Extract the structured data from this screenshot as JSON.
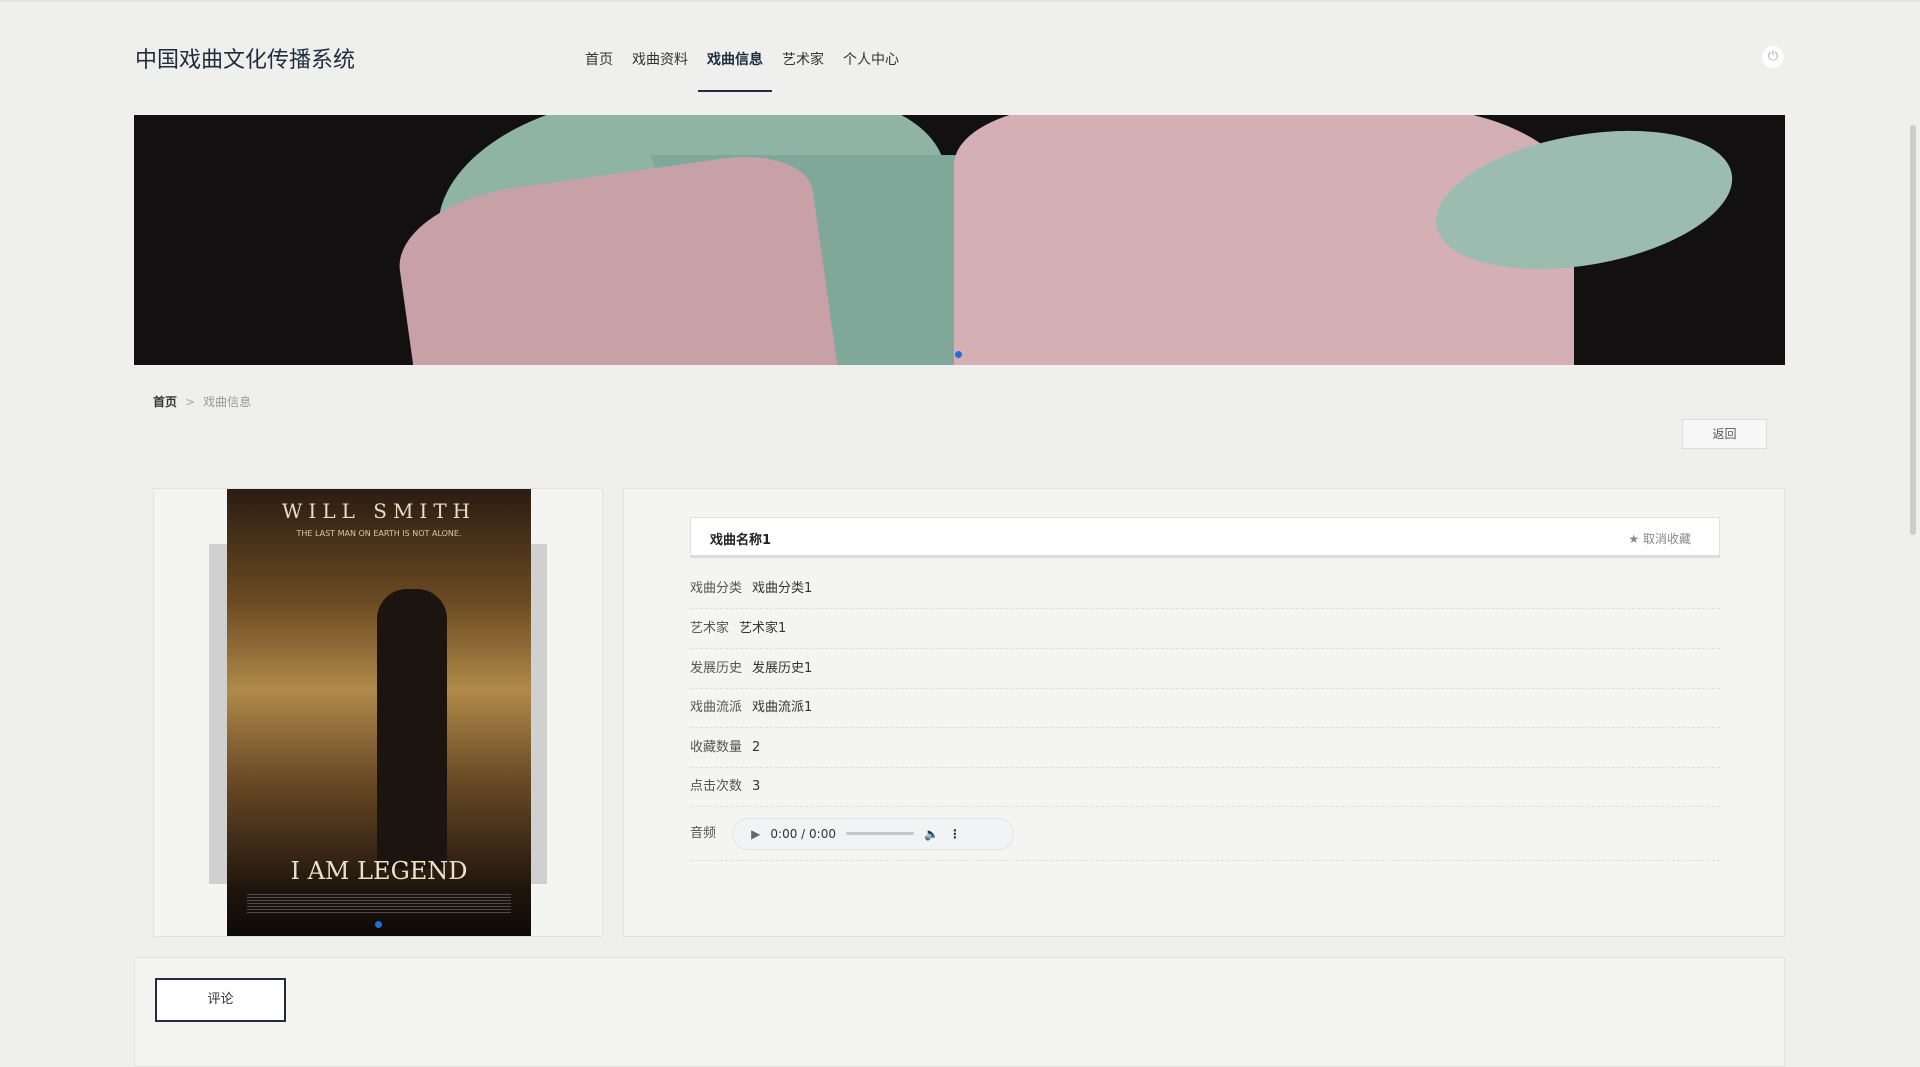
{
  "header": {
    "title": "中国戏曲文化传播系统",
    "nav": [
      "首页",
      "戏曲资料",
      "戏曲信息",
      "艺术家",
      "个人中心"
    ],
    "active_index": 2,
    "power_icon": "power-icon"
  },
  "breadcrumb": {
    "home": "首页",
    "separator": ">",
    "current": "戏曲信息"
  },
  "back_label": "返回",
  "poster": {
    "top_text": "WILL SMITH",
    "tagline": "THE LAST MAN ON EARTH IS NOT ALONE.",
    "bottom_text": "I AM LEGEND"
  },
  "detail": {
    "name": "戏曲名称1",
    "favorite_label": "取消收藏",
    "rows": [
      {
        "label": "戏曲分类",
        "value": "戏曲分类1"
      },
      {
        "label": "艺术家",
        "value": "艺术家1"
      },
      {
        "label": "发展历史",
        "value": "发展历史1"
      },
      {
        "label": "戏曲流派",
        "value": "戏曲流派1"
      },
      {
        "label": "收藏数量",
        "value": "2"
      },
      {
        "label": "点击次数",
        "value": "3"
      }
    ],
    "audio_label": "音频",
    "audio_time": "0:00 / 0:00"
  },
  "comment_label": "评论",
  "colors": {
    "accent": "#1f2d3d",
    "dot": "#1e6fd9"
  }
}
